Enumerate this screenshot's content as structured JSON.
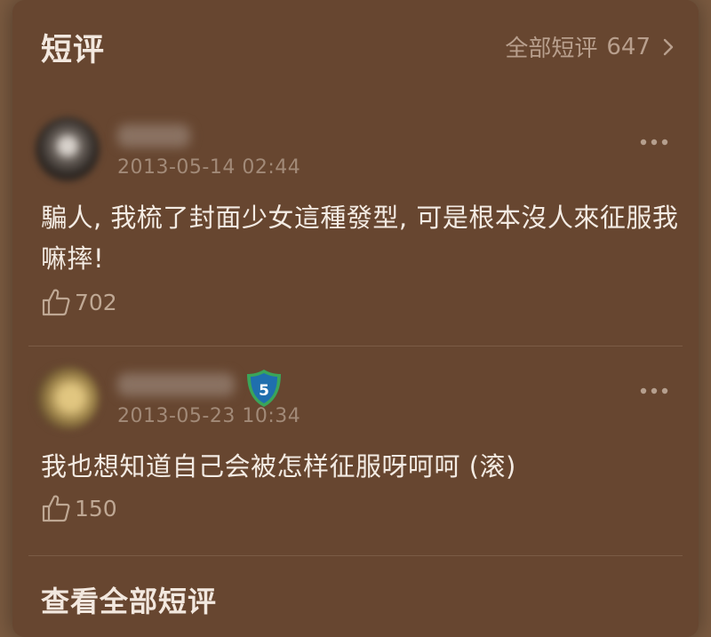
{
  "header": {
    "title": "短评",
    "all_link_label": "全部短评",
    "all_count": "647",
    "chevron_icon": "chevron-right-icon"
  },
  "comments": [
    {
      "timestamp": "2013-05-14 02:44",
      "text": "騙人, 我梳了封面少女這種發型, 可是根本沒人來征服我嘛摔!",
      "likes": "702",
      "has_badge": false
    },
    {
      "timestamp": "2013-05-23 10:34",
      "text": "我也想知道自己会被怎样征服呀呵呵 (滚)",
      "likes": "150",
      "has_badge": true,
      "badge_level": "5"
    }
  ],
  "footer": {
    "view_all_label": "查看全部短评"
  },
  "colors": {
    "page_bg": "#7a5a40",
    "panel_bg": "#674630",
    "text_primary": "#f3ebe3",
    "text_muted": "#a28a78",
    "badge_blue": "#1f6fae",
    "badge_green": "#3aa55a"
  }
}
